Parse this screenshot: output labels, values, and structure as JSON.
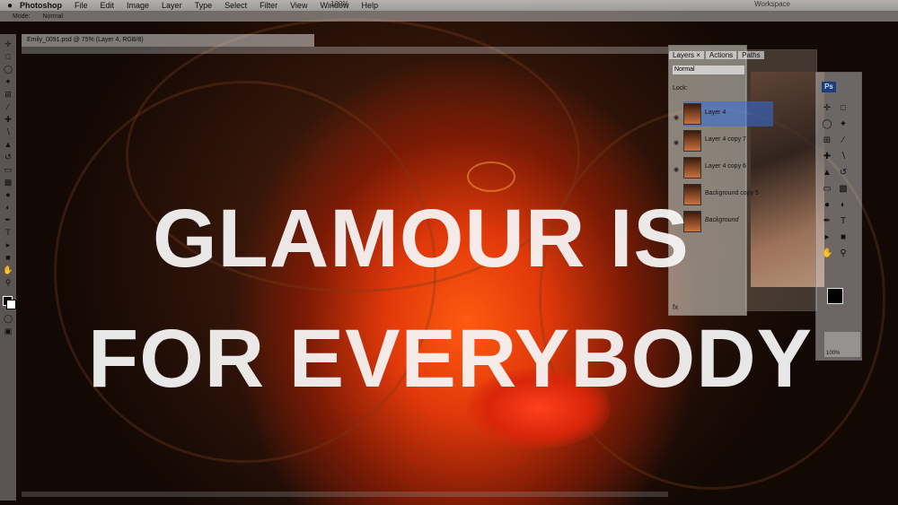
{
  "menubar": {
    "app_name": "Photoshop",
    "items": [
      "File",
      "Edit",
      "Image",
      "Layer",
      "Type",
      "Select",
      "Filter",
      "View",
      "Window",
      "Help"
    ],
    "zoom": "100%",
    "workspace": "Workspace"
  },
  "options_bar": {
    "mode_label": "Mode:",
    "mode_value": "Normal"
  },
  "document": {
    "tab_title": "Emily_0091.psd @ 75% (Layer 4, RGB/8)"
  },
  "headline": {
    "line1": "GLAMOUR IS",
    "line2": "FOR EVERYBODY"
  },
  "layers_panel": {
    "tabs": [
      "Layers ×",
      "Actions",
      "Paths"
    ],
    "blend_mode": "Normal",
    "lock_label": "Lock:",
    "layers": [
      {
        "name": "Layer 4"
      },
      {
        "name": "Layer 4 copy 7"
      },
      {
        "name": "Layer 4 copy 6"
      },
      {
        "name": "Background copy 5"
      },
      {
        "name": "Background"
      }
    ],
    "footer_icons": "fx"
  },
  "tools_palette": {
    "logo": "Ps"
  },
  "navigator": {
    "zoom": "100%"
  }
}
